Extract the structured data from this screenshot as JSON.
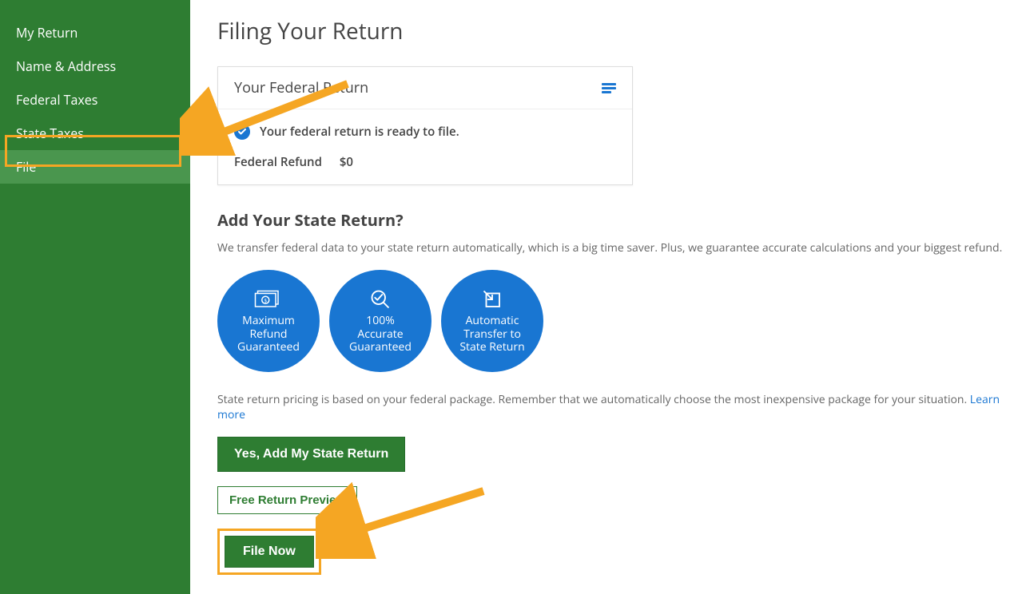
{
  "sidebar": {
    "items": [
      {
        "label": "My Return"
      },
      {
        "label": "Name & Address"
      },
      {
        "label": "Federal Taxes"
      },
      {
        "label": "State Taxes"
      },
      {
        "label": "File"
      }
    ]
  },
  "page": {
    "title": "Filing Your Return"
  },
  "federal_card": {
    "title": "Your Federal Return",
    "status": "Your federal return is ready to file.",
    "refund_label": "Federal Refund",
    "refund_value": "$0"
  },
  "state_section": {
    "heading": "Add Your State Return?",
    "description": "We transfer federal data to your state return automatically, which is a big time saver. Plus, we guarantee accurate calculations and your biggest refund.",
    "badges": [
      {
        "l1": "Maximum",
        "l2": "Refund",
        "l3": "Guaranteed"
      },
      {
        "l1": "100%",
        "l2": "Accurate",
        "l3": "Guaranteed"
      },
      {
        "l1": "Automatic",
        "l2": "Transfer to",
        "l3": "State Return"
      }
    ],
    "pricing_note": "State return pricing is based on your federal package. Remember that we automatically choose the most inexpensive package for your situation. ",
    "learn_more": "Learn more"
  },
  "buttons": {
    "add_state": "Yes, Add My State Return",
    "preview": "Free Return Preview",
    "file_now": "File Now"
  }
}
